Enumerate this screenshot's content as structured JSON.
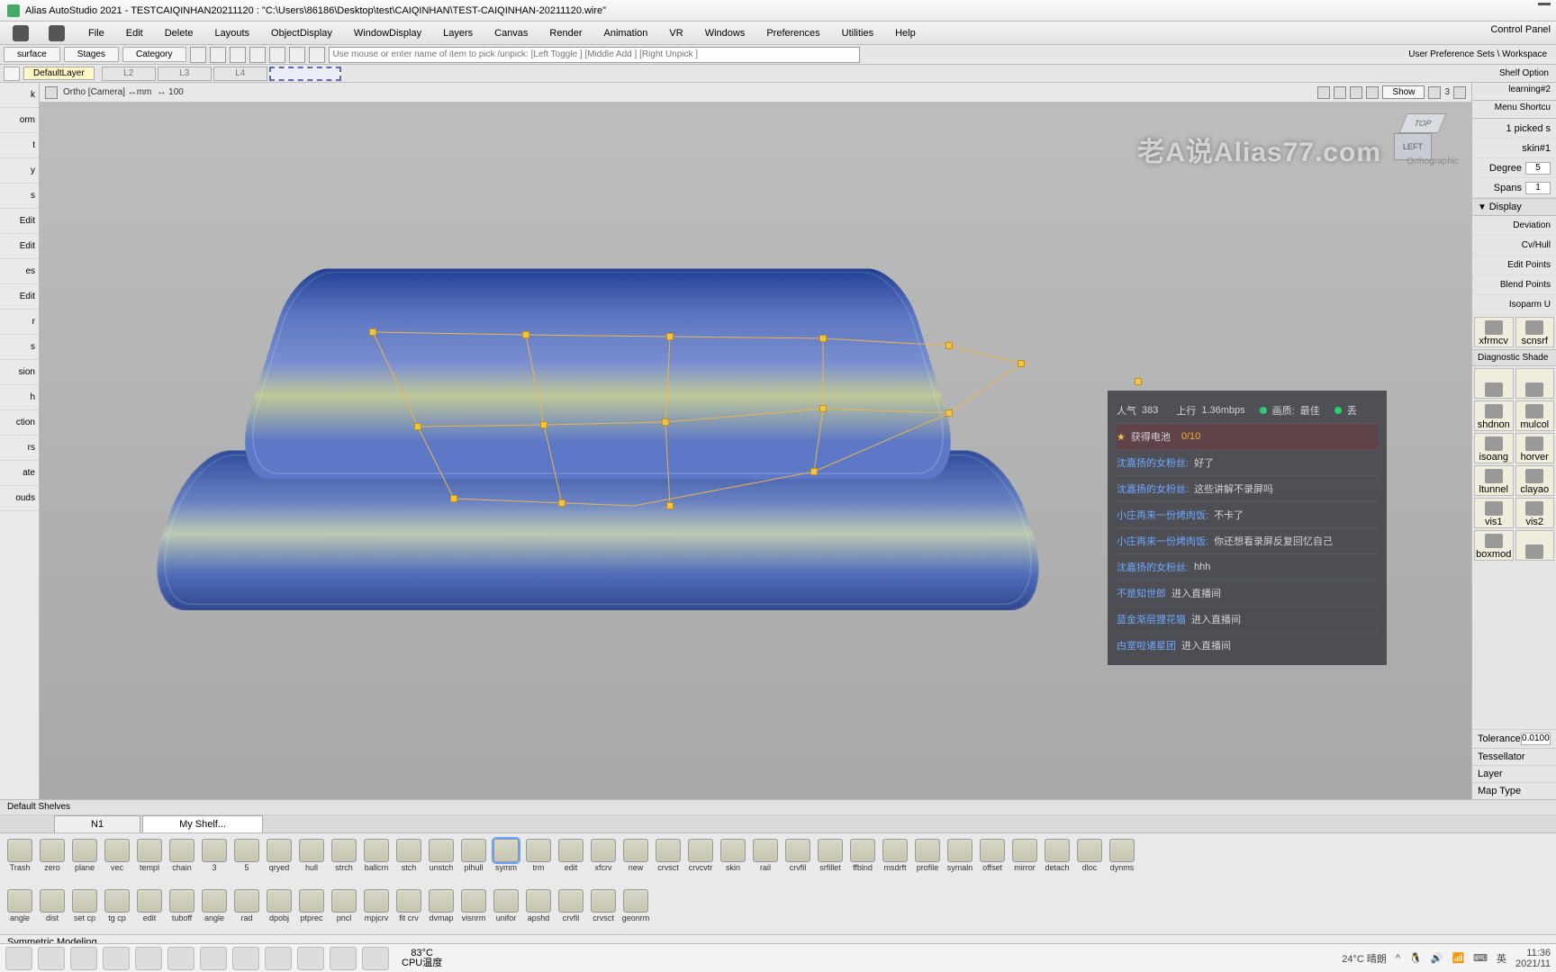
{
  "title": "Alias AutoStudio 2021    - TESTCAIQINHAN20211120 : \"C:\\Users\\86186\\Desktop\\test\\CAIQINHAN\\TEST-CAIQINHAN-20211120.wire\"",
  "menu": [
    "File",
    "Edit",
    "Delete",
    "Layouts",
    "ObjectDisplay",
    "WindowDisplay",
    "Layers",
    "Canvas",
    "Render",
    "Animation",
    "VR",
    "Windows",
    "Preferences",
    "Utilities",
    "Help"
  ],
  "control_panel": "Control Panel",
  "toolbar1": {
    "segs": [
      "surface",
      "Stages",
      "Category"
    ],
    "placeholder": "Use mouse or enter name of item to pick /unpick: [Left Toggle ] [Middle Add ] [Right Unpick ]",
    "right": "User Preference Sets \\ Workspace"
  },
  "toolbar2": {
    "layer": "DefaultLayer",
    "slots": [
      "L2",
      "L3",
      "L4",
      ""
    ],
    "shelfopt": "Shelf Option"
  },
  "viewbar": {
    "cam": "Ortho [Camera] ↔mm",
    "zoom": "↔ 100",
    "show": "Show",
    "n3": "3"
  },
  "viewcube": {
    "top": "TOP",
    "left": "LEFT",
    "ortho": "Orthographic"
  },
  "left_palette": [
    "k",
    "orm",
    "t",
    "y",
    "s",
    "Edit",
    "Edit",
    "es",
    "Edit",
    "r",
    "s",
    "sion",
    "h",
    "ction",
    "rs",
    "ate",
    "ouds"
  ],
  "right": {
    "head1": "learning#2",
    "head2": "Menu Shortcu",
    "picked": "1 picked s",
    "obj": "skin#1",
    "degree_l": "Degree",
    "degree_v": "5",
    "spans_l": "Spans",
    "spans_v": "1",
    "display": "Display",
    "rows": [
      "Deviation",
      "Cv/Hull",
      "Edit Points",
      "Blend Points",
      "Isoparm U"
    ],
    "diag": "Diagnostic Shade",
    "grid": [
      [
        "xfrmcv",
        "scnsrf"
      ],
      [
        "",
        ""
      ],
      [
        "shdnon",
        "mulcol"
      ],
      [
        "isoang",
        "horver"
      ],
      [
        "ltunnel",
        "clayao"
      ],
      [
        "vis1",
        "vis2"
      ],
      [
        "boxmod",
        ""
      ]
    ],
    "tolerance_l": "Tolerance",
    "tolerance_v": "0.0100",
    "tess": "Tessellator",
    "layer_l": "Layer",
    "maptype": "Map Type"
  },
  "watermark": "老A说Alias77.com",
  "stream": {
    "top": {
      "pop_l": "人气",
      "pop_v": "383",
      "up_l": "上行",
      "up_v": "1.36mbps",
      "q_l": "画质:",
      "q_v": "最佳",
      "x": "丢"
    },
    "battery": {
      "label": "获得电池",
      "val": "0/10"
    },
    "chat": [
      {
        "n": "沈嘉扬的女粉丝:",
        "t": "好了"
      },
      {
        "n": "沈嘉扬的女粉丝:",
        "t": "这些讲解不录屏吗"
      },
      {
        "n": "小庄再来一份烤肉饭:",
        "t": "不卡了"
      },
      {
        "n": "小庄再来一份烤肉饭:",
        "t": "你还想看录屏反复回忆自己"
      },
      {
        "n": "沈嘉扬的女粉丝:",
        "t": "hhh"
      },
      {
        "n": "不是知世郎",
        "t": "进入直播间"
      },
      {
        "n": "蓝金渐层狸花猫",
        "t": "进入直播间"
      },
      {
        "n": "甴室啦诸星团",
        "t": "进入直播间"
      }
    ]
  },
  "shelf": {
    "header": "Default Shelves",
    "tabs": [
      "N1",
      "My Shelf..."
    ],
    "row1": [
      "Trash",
      "zero",
      "plane",
      "vec",
      "templ",
      "chain",
      "3",
      "5",
      "qryed",
      "hull",
      "strch",
      "ballcrn",
      "stch",
      "unstch",
      "plhull",
      "symm",
      "trm",
      "edit",
      "xfcrv",
      "new",
      "crvsct",
      "crvcvtr",
      "skin",
      "rail",
      "crvfil",
      "srfillet",
      "ffblnd",
      "msdrft",
      "profile",
      "symaln",
      "offset",
      "mirror",
      "detach",
      "dloc",
      "dynms"
    ],
    "row2": [
      "angle",
      "dist",
      "set cp",
      "tg cp",
      "edit",
      "tuboff",
      "angle",
      "rad",
      "dpobj",
      "ptprec",
      "pncl",
      "mpjcrv",
      "fit crv",
      "dvmap",
      "visnrm",
      "unifor",
      "apshd",
      "crvfil",
      "crvsct",
      "geonrm"
    ]
  },
  "status": "Symmetric Modeling",
  "taskbar": {
    "weather": "24°C 晴朗",
    "ime": "英",
    "time": "11:36",
    "date": "2021/11",
    "temp1": "83°C",
    "temp2": "CPU温度"
  }
}
